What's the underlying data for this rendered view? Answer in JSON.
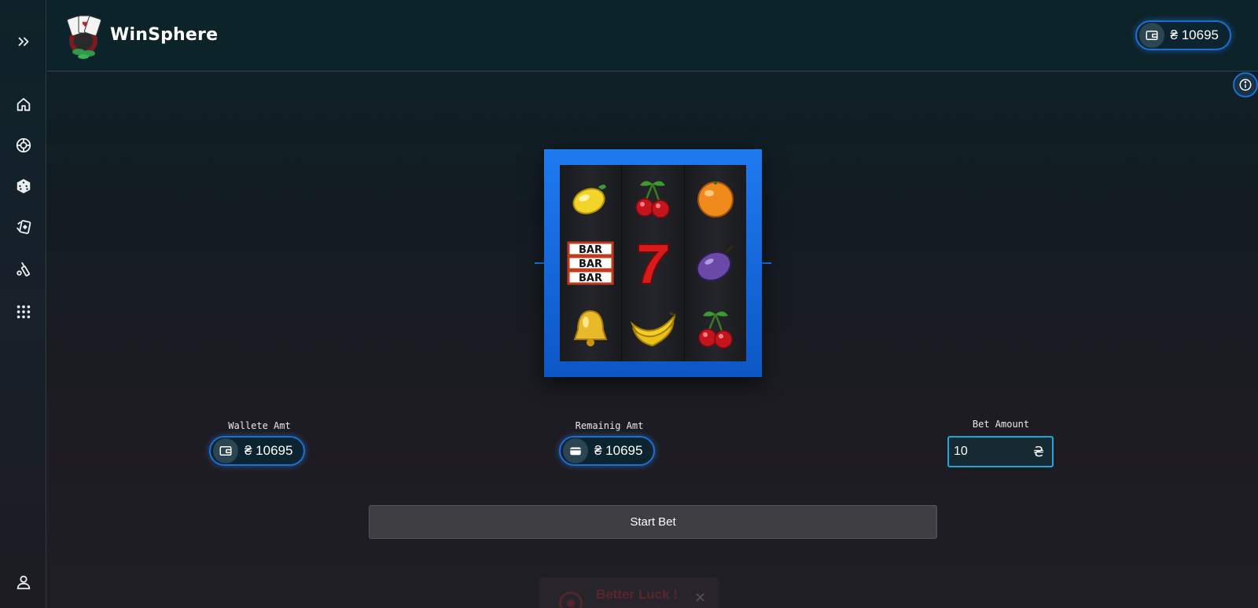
{
  "app": {
    "brand": "WinSphere",
    "currency_symbol": "₴"
  },
  "header": {
    "wallet_balance": "₴ 10695"
  },
  "sidebar": {
    "items": [
      {
        "name": "expand",
        "icon": "chevrons-right-icon"
      },
      {
        "name": "home",
        "icon": "home-icon"
      },
      {
        "name": "roulette",
        "icon": "roulette-icon"
      },
      {
        "name": "dice",
        "icon": "dice-icon"
      },
      {
        "name": "cards",
        "icon": "cards-icon"
      },
      {
        "name": "cricket",
        "icon": "cricket-icon"
      },
      {
        "name": "all-games",
        "icon": "grid-icon"
      },
      {
        "name": "profile",
        "icon": "user-icon"
      }
    ]
  },
  "slot_machine": {
    "reels": [
      [
        "lemon",
        "bar",
        "bell"
      ],
      [
        "cherry",
        "seven",
        "banana"
      ],
      [
        "orange",
        "plum",
        "cherry"
      ]
    ],
    "bar_text": "BAR"
  },
  "stats": {
    "wallet_label": "Wallete Amt",
    "wallet_value": "₴ 10695",
    "remaining_label": "Remainig Amt",
    "remaining_value": "₴ 10695",
    "bet_label": "Bet Amount",
    "bet_value": "10"
  },
  "actions": {
    "start_label": "Start Bet"
  },
  "toast": {
    "message": "Better Luck !"
  },
  "colors": {
    "accent_blue": "#1f7af0",
    "input_border": "#22a6d8",
    "toast_text": "#8b2c36"
  }
}
